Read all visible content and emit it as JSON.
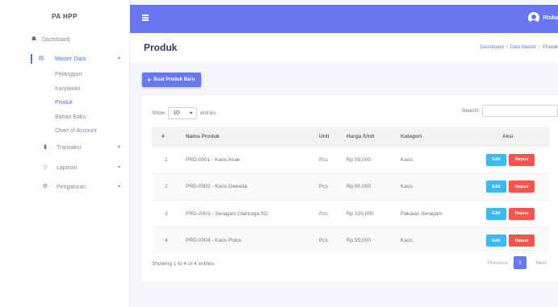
{
  "brand": "PA HPP",
  "sidebar": {
    "items": [
      {
        "label": "Dashboard",
        "icon": "home-icon"
      },
      {
        "label": "Master Data",
        "icon": "database-icon"
      },
      {
        "label": "Transaksi",
        "icon": "folder-icon"
      },
      {
        "label": "Laporan",
        "icon": "file-icon"
      },
      {
        "label": "Pengaturan",
        "icon": "cogs-icon"
      }
    ],
    "sub_items": [
      "Pelanggan",
      "Karyawan",
      "Produk",
      "Bahan Baku",
      "Chart of Account"
    ]
  },
  "topbar": {
    "user": "Riska"
  },
  "header": {
    "title": "Produk",
    "breadcrumb": [
      "Dashboard",
      "Data Master",
      "Produk"
    ]
  },
  "add_button": "Buat Produk Baru",
  "table": {
    "length": {
      "show": "Show",
      "value": "10",
      "entries": "entries"
    },
    "search_label": "Search:",
    "columns": [
      "#",
      "Nama Produk",
      "Unit",
      "Harga /Unit",
      "Kategori",
      "Aksi"
    ],
    "rows": [
      {
        "no": "1",
        "nama": "PRD-0001 - Kaos Anak",
        "unit": "Pcs",
        "harga": "Rp 55,000",
        "kategori": "Kaos"
      },
      {
        "no": "2",
        "nama": "PRD-0002 - Kaos Dewasa",
        "unit": "Pcs",
        "harga": "Rp 60,000",
        "kategori": "Kaos"
      },
      {
        "no": "3",
        "nama": "PRD-0003 - Seragam Olahraga SD",
        "unit": "Pcs",
        "harga": "Rp 120,000",
        "kategori": "Pakaian Seragam"
      },
      {
        "no": "4",
        "nama": "PRD-0004 - Kaos Polos",
        "unit": "Pcs",
        "harga": "Rp 55,000",
        "kategori": "Kaos"
      }
    ],
    "edit_label": "Edit",
    "delete_label": "Hapus",
    "info": "Showing 1 to 4 of 4 entries",
    "pagination": {
      "prev": "Previous",
      "page": "1",
      "next": "Next"
    }
  },
  "colors": {
    "primary": "#6777ef",
    "info": "#3abaf4",
    "danger": "#fc544b"
  }
}
